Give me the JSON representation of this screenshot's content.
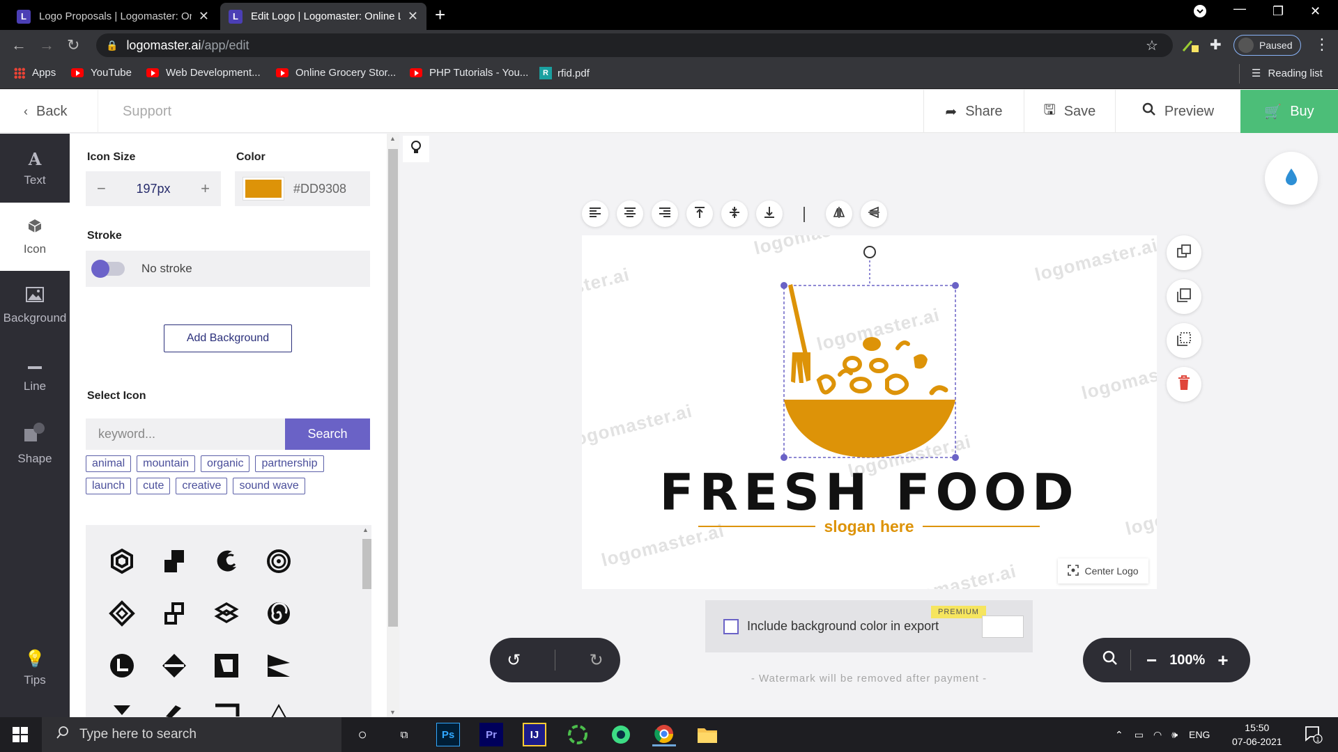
{
  "browser": {
    "tabs": [
      {
        "favicon": "L",
        "title": "Logo Proposals | Logomaster: Online Logo Maker",
        "active": false
      },
      {
        "favicon": "L",
        "title": "Edit Logo | Logomaster: Online Logo Maker",
        "active": true
      }
    ],
    "url_host": "logomaster.ai",
    "url_path": "/app/edit",
    "profile_status": "Paused",
    "bookmarks": [
      "Apps",
      "YouTube",
      "Web Development...",
      "Online Grocery Stor...",
      "PHP Tutorials - You...",
      "rfid.pdf"
    ],
    "reading_list": "Reading list"
  },
  "header": {
    "back": "Back",
    "support": "Support",
    "share": "Share",
    "save": "Save",
    "preview": "Preview",
    "buy": "Buy"
  },
  "rail": [
    {
      "label": "Text",
      "icon": "text-icon",
      "active": false
    },
    {
      "label": "Icon",
      "icon": "cube-icon",
      "active": true
    },
    {
      "label": "Background",
      "icon": "image-icon",
      "active": false
    },
    {
      "label": "Line",
      "icon": "line-icon",
      "active": false
    },
    {
      "label": "Shape",
      "icon": "shape-icon",
      "active": false
    },
    {
      "label": "Tips",
      "icon": "bulb-icon",
      "active": false
    }
  ],
  "panel": {
    "icon_size_label": "Icon Size",
    "icon_size_value": "197px",
    "color_label": "Color",
    "color_value": "#DD9308",
    "stroke_label": "Stroke",
    "stroke_value": "No stroke",
    "add_background": "Add Background",
    "select_icon_label": "Select Icon",
    "keyword_placeholder": "keyword...",
    "search_button": "Search",
    "tags": [
      "animal",
      "mountain",
      "organic",
      "partnership",
      "launch",
      "cute",
      "creative",
      "sound wave"
    ]
  },
  "canvas": {
    "brand_name": "FRESH FOOD",
    "slogan": "slogan here",
    "watermark": "logomaster.ai",
    "center_logo": "Center Logo",
    "accent_color": "#DD9308",
    "export_label": "Include background color in export",
    "premium_badge": "PREMIUM",
    "watermark_note": "- Watermark will be removed after payment -",
    "zoom": "100%"
  },
  "taskbar": {
    "search_placeholder": "Type here to search",
    "lang": "ENG",
    "time": "15:50",
    "date": "07-06-2021",
    "notifications": "1"
  }
}
